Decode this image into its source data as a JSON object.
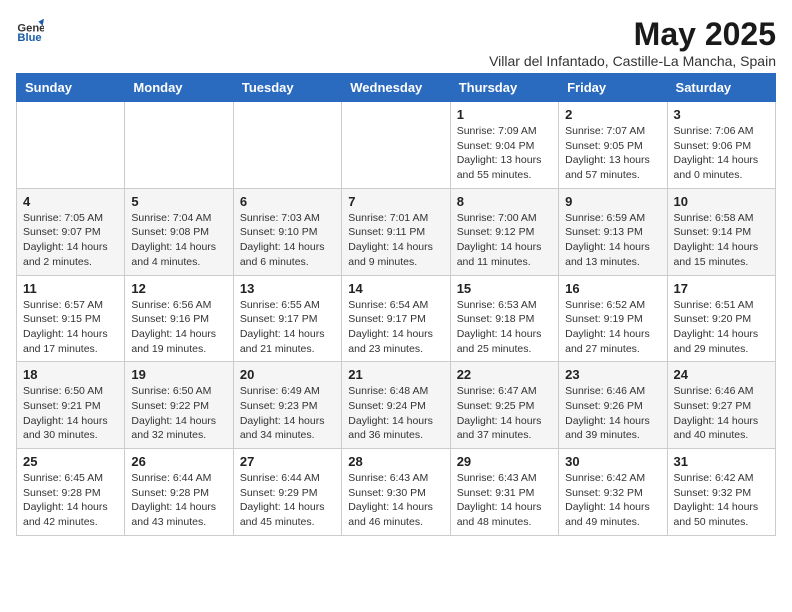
{
  "logo": {
    "general": "General",
    "blue": "Blue"
  },
  "title": "May 2025",
  "subtitle": "Villar del Infantado, Castille-La Mancha, Spain",
  "headers": [
    "Sunday",
    "Monday",
    "Tuesday",
    "Wednesday",
    "Thursday",
    "Friday",
    "Saturday"
  ],
  "weeks": [
    [
      {
        "day": "",
        "info": ""
      },
      {
        "day": "",
        "info": ""
      },
      {
        "day": "",
        "info": ""
      },
      {
        "day": "",
        "info": ""
      },
      {
        "day": "1",
        "info": "Sunrise: 7:09 AM\nSunset: 9:04 PM\nDaylight: 13 hours\nand 55 minutes."
      },
      {
        "day": "2",
        "info": "Sunrise: 7:07 AM\nSunset: 9:05 PM\nDaylight: 13 hours\nand 57 minutes."
      },
      {
        "day": "3",
        "info": "Sunrise: 7:06 AM\nSunset: 9:06 PM\nDaylight: 14 hours\nand 0 minutes."
      }
    ],
    [
      {
        "day": "4",
        "info": "Sunrise: 7:05 AM\nSunset: 9:07 PM\nDaylight: 14 hours\nand 2 minutes."
      },
      {
        "day": "5",
        "info": "Sunrise: 7:04 AM\nSunset: 9:08 PM\nDaylight: 14 hours\nand 4 minutes."
      },
      {
        "day": "6",
        "info": "Sunrise: 7:03 AM\nSunset: 9:10 PM\nDaylight: 14 hours\nand 6 minutes."
      },
      {
        "day": "7",
        "info": "Sunrise: 7:01 AM\nSunset: 9:11 PM\nDaylight: 14 hours\nand 9 minutes."
      },
      {
        "day": "8",
        "info": "Sunrise: 7:00 AM\nSunset: 9:12 PM\nDaylight: 14 hours\nand 11 minutes."
      },
      {
        "day": "9",
        "info": "Sunrise: 6:59 AM\nSunset: 9:13 PM\nDaylight: 14 hours\nand 13 minutes."
      },
      {
        "day": "10",
        "info": "Sunrise: 6:58 AM\nSunset: 9:14 PM\nDaylight: 14 hours\nand 15 minutes."
      }
    ],
    [
      {
        "day": "11",
        "info": "Sunrise: 6:57 AM\nSunset: 9:15 PM\nDaylight: 14 hours\nand 17 minutes."
      },
      {
        "day": "12",
        "info": "Sunrise: 6:56 AM\nSunset: 9:16 PM\nDaylight: 14 hours\nand 19 minutes."
      },
      {
        "day": "13",
        "info": "Sunrise: 6:55 AM\nSunset: 9:17 PM\nDaylight: 14 hours\nand 21 minutes."
      },
      {
        "day": "14",
        "info": "Sunrise: 6:54 AM\nSunset: 9:17 PM\nDaylight: 14 hours\nand 23 minutes."
      },
      {
        "day": "15",
        "info": "Sunrise: 6:53 AM\nSunset: 9:18 PM\nDaylight: 14 hours\nand 25 minutes."
      },
      {
        "day": "16",
        "info": "Sunrise: 6:52 AM\nSunset: 9:19 PM\nDaylight: 14 hours\nand 27 minutes."
      },
      {
        "day": "17",
        "info": "Sunrise: 6:51 AM\nSunset: 9:20 PM\nDaylight: 14 hours\nand 29 minutes."
      }
    ],
    [
      {
        "day": "18",
        "info": "Sunrise: 6:50 AM\nSunset: 9:21 PM\nDaylight: 14 hours\nand 30 minutes."
      },
      {
        "day": "19",
        "info": "Sunrise: 6:50 AM\nSunset: 9:22 PM\nDaylight: 14 hours\nand 32 minutes."
      },
      {
        "day": "20",
        "info": "Sunrise: 6:49 AM\nSunset: 9:23 PM\nDaylight: 14 hours\nand 34 minutes."
      },
      {
        "day": "21",
        "info": "Sunrise: 6:48 AM\nSunset: 9:24 PM\nDaylight: 14 hours\nand 36 minutes."
      },
      {
        "day": "22",
        "info": "Sunrise: 6:47 AM\nSunset: 9:25 PM\nDaylight: 14 hours\nand 37 minutes."
      },
      {
        "day": "23",
        "info": "Sunrise: 6:46 AM\nSunset: 9:26 PM\nDaylight: 14 hours\nand 39 minutes."
      },
      {
        "day": "24",
        "info": "Sunrise: 6:46 AM\nSunset: 9:27 PM\nDaylight: 14 hours\nand 40 minutes."
      }
    ],
    [
      {
        "day": "25",
        "info": "Sunrise: 6:45 AM\nSunset: 9:28 PM\nDaylight: 14 hours\nand 42 minutes."
      },
      {
        "day": "26",
        "info": "Sunrise: 6:44 AM\nSunset: 9:28 PM\nDaylight: 14 hours\nand 43 minutes."
      },
      {
        "day": "27",
        "info": "Sunrise: 6:44 AM\nSunset: 9:29 PM\nDaylight: 14 hours\nand 45 minutes."
      },
      {
        "day": "28",
        "info": "Sunrise: 6:43 AM\nSunset: 9:30 PM\nDaylight: 14 hours\nand 46 minutes."
      },
      {
        "day": "29",
        "info": "Sunrise: 6:43 AM\nSunset: 9:31 PM\nDaylight: 14 hours\nand 48 minutes."
      },
      {
        "day": "30",
        "info": "Sunrise: 6:42 AM\nSunset: 9:32 PM\nDaylight: 14 hours\nand 49 minutes."
      },
      {
        "day": "31",
        "info": "Sunrise: 6:42 AM\nSunset: 9:32 PM\nDaylight: 14 hours\nand 50 minutes."
      }
    ]
  ]
}
